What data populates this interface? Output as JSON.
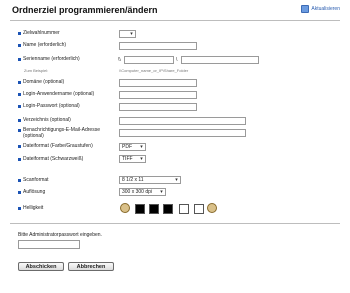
{
  "page": {
    "title": "Ordnerziel programmieren/ändern",
    "refresh_label": "Aktualisieren"
  },
  "form": {
    "zielwahl": {
      "label": "Zielwahlnummer",
      "value": ""
    },
    "name": {
      "label": "Name (erforderlich)",
      "value": ""
    },
    "serien": {
      "label": "Serienname (erforderlich)",
      "sep1": "\\\\",
      "sep2": "\\",
      "hint": "Zum Beispiel:",
      "example": "\\\\Computer_name_or_IP\\Share_Folder"
    },
    "domaene": {
      "label": "Domäne (optional)",
      "value": ""
    },
    "login_user": {
      "label": "Login-Anwendername (optional)",
      "value": ""
    },
    "login_pass": {
      "label": "Login-Passwort (optional)",
      "value": ""
    },
    "verzeichnis": {
      "label": "Verzeichnis (optional)",
      "value": ""
    },
    "mail": {
      "label": "Benachrichtigungs-E-Mail-Adresse (optional)",
      "value": ""
    },
    "format_color": {
      "label": "Dateiformat (Farbe/Graustufen)",
      "value": "PDF"
    },
    "format_bw": {
      "label": "Dateiformat (Schwarzweiß)",
      "value": "TIFF"
    },
    "scanformat": {
      "label": "Scanformat",
      "value": "8 1/2 x 11"
    },
    "aufloesung": {
      "label": "Auflösung",
      "value": "300 x 300 dpi"
    },
    "helligkeit": {
      "label": "Helligkeit"
    }
  },
  "admin": {
    "prompt": "Bitte Administratorpasswort eingeben.",
    "value": ""
  },
  "buttons": {
    "submit": "Abschicken",
    "cancel": "Abbrechen"
  },
  "colors": {
    "accent": "#1b53b5",
    "title": "#111111"
  }
}
